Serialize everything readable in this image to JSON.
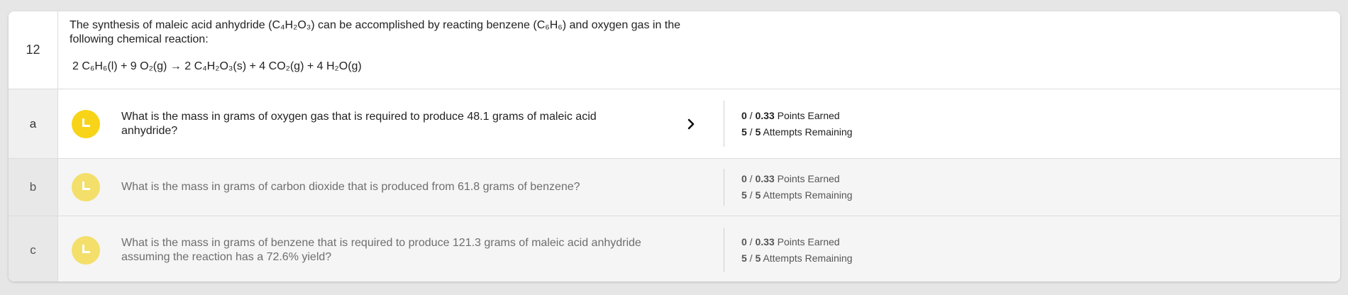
{
  "problem": {
    "number": "12",
    "prompt": "The synthesis of maleic acid anhydride (C₄H₂O₃) can be accomplished by reacting benzene (C₆H₆) and oxygen gas in the following chemical reaction:",
    "equation": "2 C₆H₆(l) + 9 O₂(g) → 2 C₄H₂O₃(s) + 4 CO₂(g) + 4 H₂O(g)"
  },
  "parts": [
    {
      "label": "a",
      "question": "What is the mass in grams of oxygen gas that is required to produce 48.1 grams of maleic acid anhydride?",
      "points_earned": "0",
      "points_total": "0.33",
      "points_text": "Points Earned",
      "attempts_left": "5",
      "attempts_total": "5",
      "attempts_text": "Attempts Remaining",
      "active": true
    },
    {
      "label": "b",
      "question": "What is the mass in grams of carbon dioxide that is produced from 61.8 grams of benzene?",
      "points_earned": "0",
      "points_total": "0.33",
      "points_text": "Points Earned",
      "attempts_left": "5",
      "attempts_total": "5",
      "attempts_text": "Attempts Remaining",
      "active": false
    },
    {
      "label": "c",
      "question": "What is the mass in grams of benzene that is required to produce 121.3 grams of maleic acid anhydride assuming the reaction has a 72.6% yield?",
      "points_earned": "0",
      "points_total": "0.33",
      "points_text": "Points Earned",
      "attempts_left": "5",
      "attempts_total": "5",
      "attempts_text": "Attempts Remaining",
      "active": false
    }
  ],
  "separator": " / ",
  "icons": {
    "status": "clock-icon",
    "expand": "chevron-right-icon"
  },
  "colors": {
    "status_active": "#f7d417",
    "status_inactive": "#f3df6a",
    "inactive_row_bg": "#f5f5f5"
  }
}
